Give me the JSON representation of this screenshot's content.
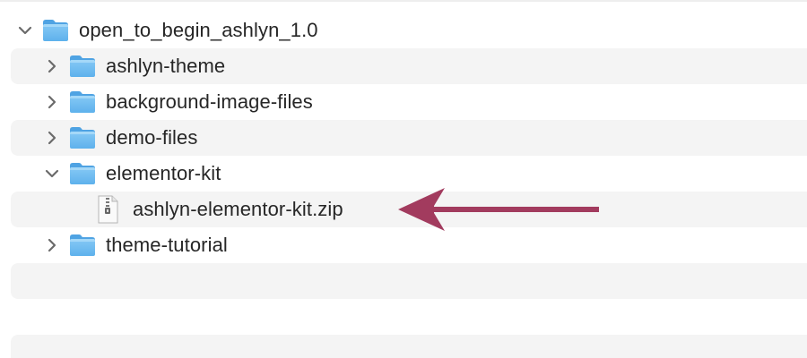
{
  "window": {
    "view": "Finder list view"
  },
  "tree": {
    "root": {
      "label": "open_to_begin_ashlyn_1.0",
      "expanded": true,
      "icon": "folder-icon"
    },
    "items": [
      {
        "label": "ashlyn-theme",
        "type": "folder",
        "expanded": false,
        "icon": "folder-icon"
      },
      {
        "label": "background-image-files",
        "type": "folder",
        "expanded": false,
        "icon": "folder-icon"
      },
      {
        "label": "demo-files",
        "type": "folder",
        "expanded": false,
        "icon": "folder-icon"
      },
      {
        "label": "elementor-kit",
        "type": "folder",
        "expanded": true,
        "icon": "folder-icon"
      },
      {
        "label": "ashlyn-elementor-kit.zip",
        "type": "file",
        "icon": "zip-file-icon"
      },
      {
        "label": "theme-tutorial",
        "type": "folder",
        "expanded": false,
        "icon": "folder-icon"
      }
    ]
  },
  "annotation": {
    "icon": "arrow-left-icon",
    "color": "#A23B5E"
  },
  "colors": {
    "folder_light": "#8ECDF4",
    "folder_dark": "#5AAEEA",
    "row_stripe": "#F4F4F4",
    "text": "#262626"
  }
}
